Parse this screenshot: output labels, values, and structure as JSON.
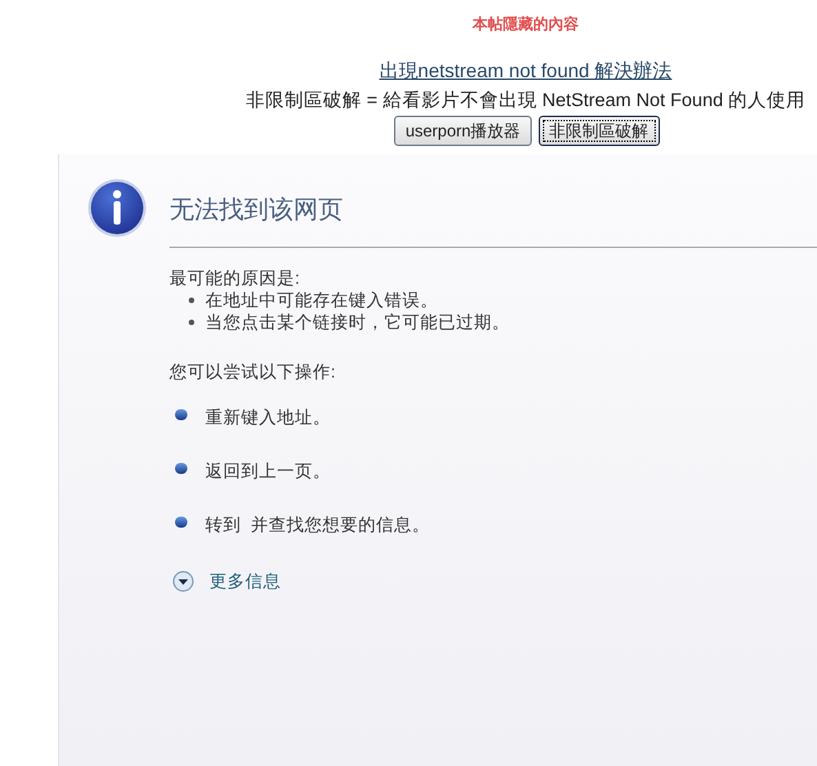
{
  "hidden_notice": "本帖隱藏的內容",
  "help_link": "出現netstream not found 解決辦法",
  "note": "非限制區破解 = 給看影片不會出現 NetStream Not Found 的人使用",
  "buttons": [
    {
      "label": "userporn播放器",
      "focused": false
    },
    {
      "label": "非限制區破解",
      "focused": true
    }
  ],
  "error_page": {
    "title": "无法找到该网页",
    "causes_heading": "最可能的原因是:",
    "causes": [
      "在地址中可能存在键入错误。",
      "当您点击某个链接时，它可能已过期。"
    ],
    "actions_heading": "您可以尝试以下操作:",
    "actions": [
      "重新键入地址。",
      "返回到上一页。",
      "转到  并查找您想要的信息。"
    ],
    "more_info": "更多信息"
  }
}
